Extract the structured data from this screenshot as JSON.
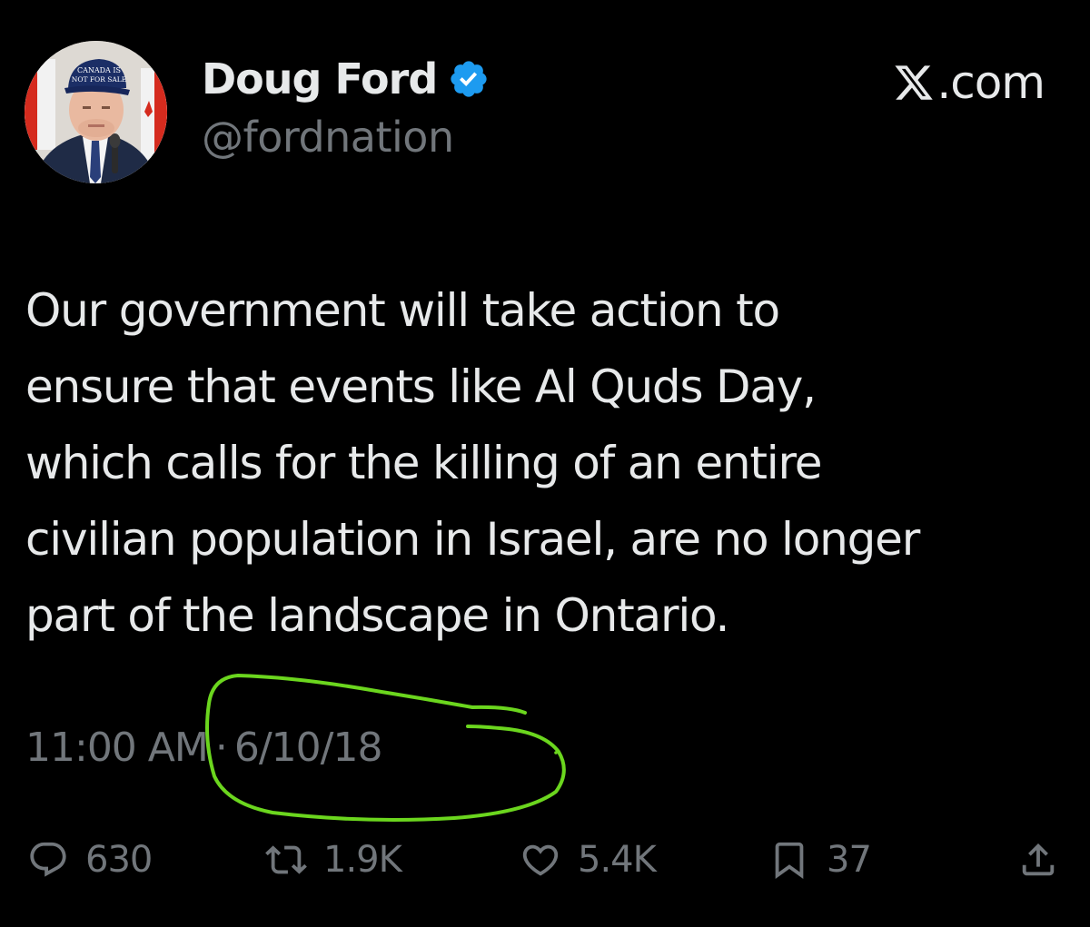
{
  "author": {
    "display_name": "Doug Ford",
    "handle": "@fordnation",
    "verified_icon": "verified-badge-icon",
    "avatar_cap_text": [
      "CANADA IS",
      "NOT FOR SALE"
    ]
  },
  "brand": {
    "icon": "x-logo-icon",
    "text": ".com"
  },
  "tweet": {
    "lines": [
      "Our government will take action to",
      "ensure that events like Al Quds Day,",
      "which calls for the killing of an entire",
      "civilian population in Israel, are no longer",
      "part of the landscape in Ontario."
    ],
    "time": "11:00 AM",
    "separator": "·",
    "date": "6/10/18"
  },
  "actions": {
    "reply": {
      "icon": "reply-icon",
      "count": "630"
    },
    "retweet": {
      "icon": "retweet-icon",
      "count": "1.9K"
    },
    "like": {
      "icon": "heart-icon",
      "count": "5.4K"
    },
    "bookmark": {
      "icon": "bookmark-icon",
      "count": "37"
    },
    "share": {
      "icon": "share-icon"
    }
  },
  "colors": {
    "background": "#000000",
    "text_primary": "#e7e9ea",
    "text_secondary": "#71767b",
    "verified_blue": "#1d9bf0",
    "annotation_green": "#6bd61e"
  }
}
